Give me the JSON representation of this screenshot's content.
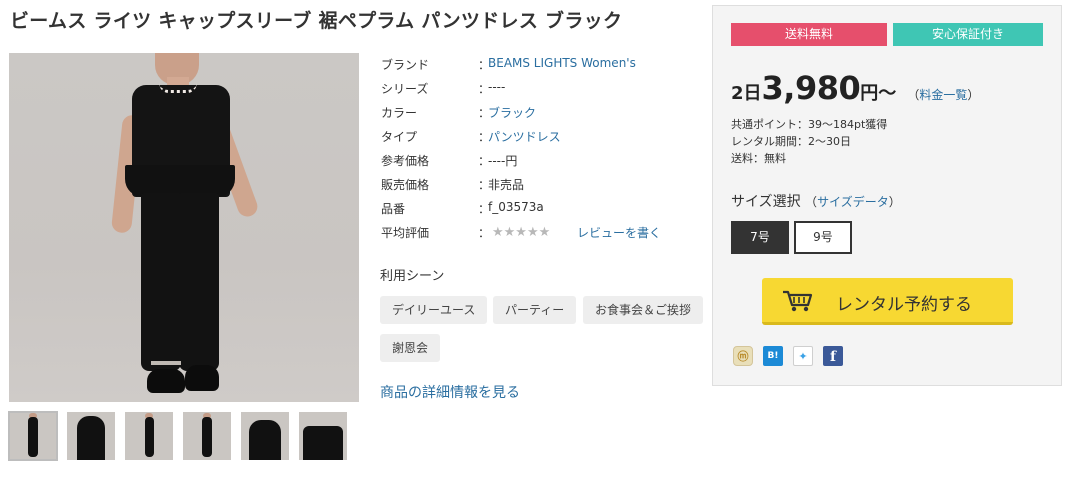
{
  "product": {
    "title": "ビームス ライツ キャップスリーブ 裾ペプラム パンツドレス ブラック"
  },
  "specs": {
    "colon": "：",
    "rows": [
      {
        "label": "ブランド",
        "value": "BEAMS LIGHTS Women's"
      },
      {
        "label": "シリーズ",
        "value": "----"
      },
      {
        "label": "カラー",
        "value": "ブラック"
      },
      {
        "label": "タイプ",
        "value": "パンツドレス"
      },
      {
        "label": "参考価格",
        "value": "----円"
      },
      {
        "label": "販売価格",
        "value": "非売品"
      },
      {
        "label": "品番",
        "value": "f_03573a"
      },
      {
        "label": "平均評価",
        "value": ""
      }
    ],
    "stars": "★★★★★",
    "rating": 0,
    "review_link": "レビューを書く"
  },
  "scene": {
    "heading": "利用シーン",
    "tags": [
      "デイリーユース",
      "パーティー",
      "お食事会＆ご挨拶",
      "謝恩会"
    ]
  },
  "detail_link": "商品の詳細情報を見る",
  "panel": {
    "badge_shipping": "送料無料",
    "badge_guarantee": "安心保証付き",
    "price_days": "2日",
    "price_amount": "3,980",
    "price_unit": "円〜",
    "price_list_open": "（",
    "price_list_link": "料金一覧",
    "price_list_close": "）",
    "points": "共通ポイント：39〜184pt獲得",
    "period": "レンタル期間：2〜30日",
    "shipping": "送料：無料",
    "size_heading": "サイズ選択",
    "size_data_open": "（",
    "size_data_link": "サイズデータ",
    "size_data_close": "）",
    "sizes": [
      "7号",
      "9号"
    ],
    "selected_size": "7号",
    "reserve_label": "レンタル予約する",
    "share_icons": [
      "mixi-icon",
      "hatena-bookmark-icon",
      "twitter-icon",
      "facebook-icon"
    ],
    "share_glyphs": {
      "mixi": "ⓜ",
      "hatena": "B!",
      "twitter": "✦",
      "facebook": "f"
    }
  },
  "colors": {
    "link": "#2a6ea0",
    "badge_red": "#e64f6c",
    "badge_teal": "#3fc6b4",
    "reserve_yellow": "#f7d832",
    "selected_size": "#333333"
  }
}
